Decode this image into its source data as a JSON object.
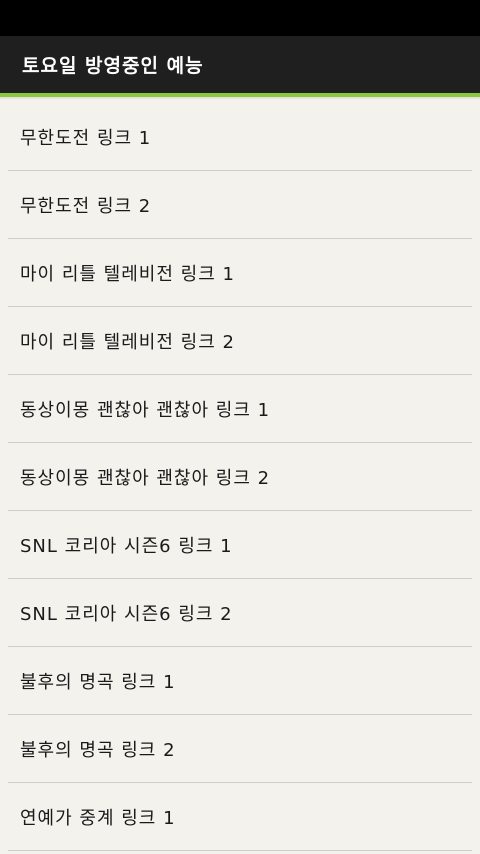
{
  "action_bar": {
    "title": "토요일 방영중인 예능"
  },
  "list": {
    "items": [
      {
        "label": "무한도전 링크 1"
      },
      {
        "label": "무한도전 링크 2"
      },
      {
        "label": "마이 리틀 텔레비전 링크 1"
      },
      {
        "label": "마이 리틀 텔레비전 링크 2"
      },
      {
        "label": "동상이몽 괜찮아 괜찮아 링크 1"
      },
      {
        "label": "동상이몽 괜찮아 괜찮아 링크 2"
      },
      {
        "label": "SNL 코리아 시즌6 링크 1"
      },
      {
        "label": "SNL 코리아 시즌6 링크 2"
      },
      {
        "label": "불후의 명곡 링크 1"
      },
      {
        "label": "불후의 명곡 링크 2"
      },
      {
        "label": "연예가 중계 링크 1"
      }
    ]
  },
  "colors": {
    "accent": "#8cc63f",
    "action_bar_bg": "#1f1f1f",
    "list_bg": "#f3f2ec",
    "divider": "#cfcec8"
  }
}
